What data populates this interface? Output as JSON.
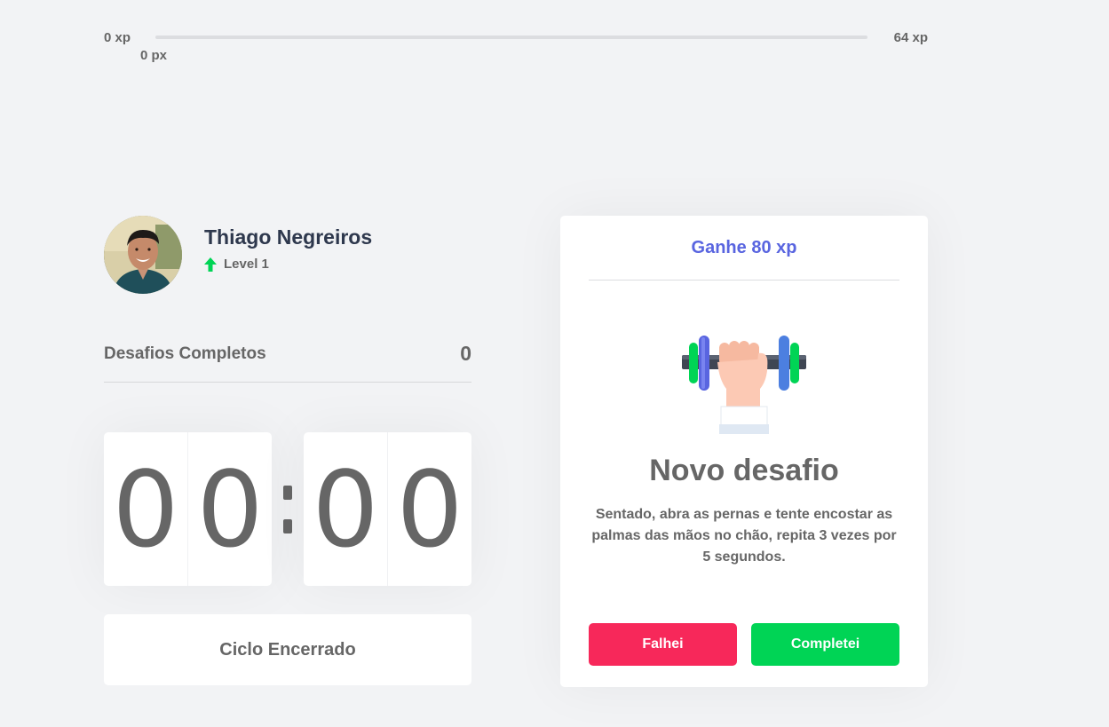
{
  "experience": {
    "min_label": "0 xp",
    "max_label": "64 xp",
    "current_label": "0 px",
    "progress_fraction": 0
  },
  "profile": {
    "name": "Thiago Negreiros",
    "level_label": "Level 1",
    "level_icon": "arrow-up-icon",
    "level_icon_color": "#00d455"
  },
  "challenges": {
    "label": "Desafios Completos",
    "count": "0"
  },
  "countdown": {
    "minute_left": "0",
    "minute_right": "0",
    "second_left": "0",
    "second_right": "0",
    "separator": ":"
  },
  "cycle_button": {
    "label": "Ciclo Encerrado"
  },
  "challenge_card": {
    "reward": "Ganhe 80 xp",
    "icon": "dumbbell-icon",
    "title": "Novo desafio",
    "description": "Sentado, abra as pernas e tente encostar as palmas das mãos no chão, repita 3 vezes por 5 segundos.",
    "fail_label": "Falhei",
    "complete_label": "Completei"
  },
  "colors": {
    "background": "#f2f3f5",
    "reward_blue": "#5965e0",
    "fail_red": "#f7285a",
    "success_green": "#00d455",
    "text_gray": "#666666",
    "title_dark": "#2e384d"
  }
}
